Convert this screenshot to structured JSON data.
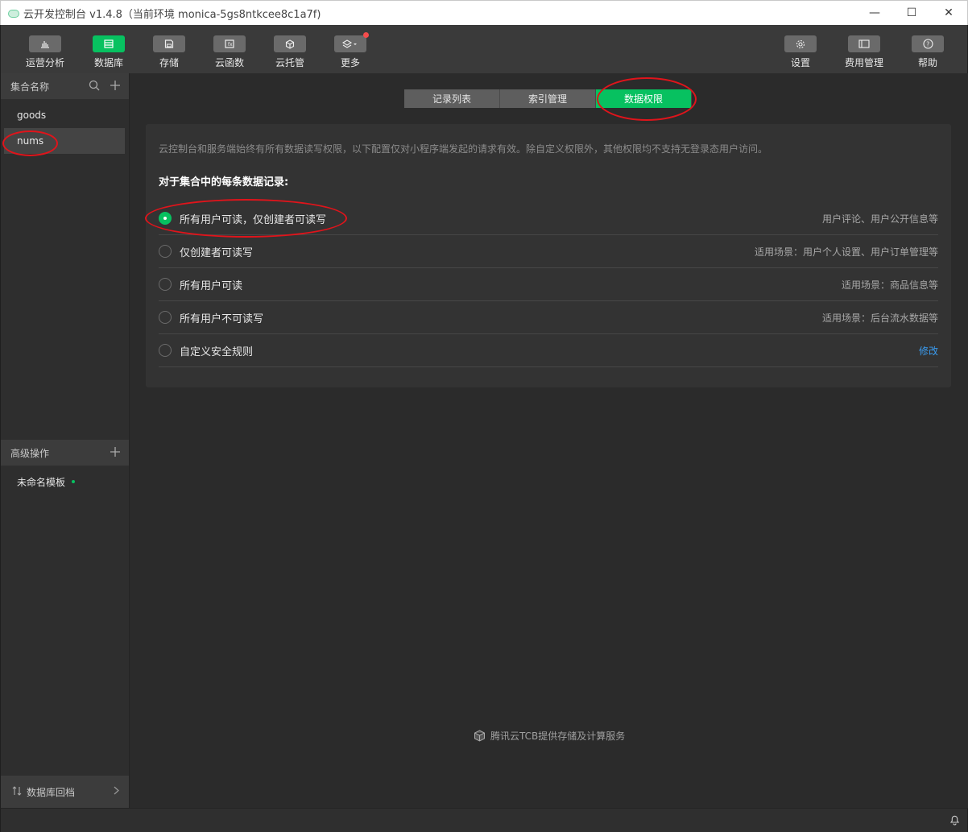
{
  "window": {
    "title": "云开发控制台 v1.4.8（当前环境 monica-5gs8ntkcee8c1a7f)",
    "minimize_glyph": "—",
    "maximize_glyph": "☐",
    "close_glyph": "✕"
  },
  "toolbar": {
    "left": [
      {
        "label": "运营分析",
        "icon": "bar-chart-icon",
        "active": false
      },
      {
        "label": "数据库",
        "icon": "database-icon",
        "active": true
      },
      {
        "label": "存储",
        "icon": "save-icon",
        "active": false
      },
      {
        "label": "云函数",
        "icon": "function-icon",
        "active": false
      },
      {
        "label": "云托管",
        "icon": "cube-icon",
        "active": false
      },
      {
        "label": "更多",
        "icon": "layers-icon",
        "active": false,
        "notification_dot": true
      }
    ],
    "right": [
      {
        "label": "设置",
        "icon": "gear-icon"
      },
      {
        "label": "费用管理",
        "icon": "billing-icon"
      },
      {
        "label": "帮助",
        "icon": "help-icon"
      }
    ]
  },
  "sidebar": {
    "collections_header": "集合名称",
    "collections": [
      {
        "name": "goods",
        "selected": false
      },
      {
        "name": "nums",
        "selected": true
      }
    ],
    "advanced_header": "高级操作",
    "advanced_items": [
      {
        "name": "未命名模板",
        "status_dot": true
      }
    ],
    "footer_label": "数据库回档"
  },
  "main": {
    "tabs": [
      {
        "label": "记录列表",
        "active": false
      },
      {
        "label": "索引管理",
        "active": false
      },
      {
        "label": "数据权限",
        "active": true
      }
    ],
    "description": "云控制台和服务端始终有所有数据读写权限，以下配置仅对小程序端发起的请求有效。除自定义权限外，其他权限均不支持无登录态用户访问。",
    "subheading": "对于集合中的每条数据记录:",
    "options": [
      {
        "label": "所有用户可读，仅创建者可读写",
        "note": "用户评论、用户公开信息等",
        "checked": true
      },
      {
        "label": "仅创建者可读写",
        "note": "适用场景：用户个人设置、用户订单管理等",
        "checked": false
      },
      {
        "label": "所有用户可读",
        "note": "适用场景：商品信息等",
        "checked": false
      },
      {
        "label": "所有用户不可读写",
        "note": "适用场景：后台流水数据等",
        "checked": false
      },
      {
        "label": "自定义安全规则",
        "note": "修改",
        "checked": false,
        "note_is_link": true
      }
    ],
    "provider": "腾讯云TCB提供存储及计算服务"
  },
  "colors": {
    "accent": "#07c160",
    "annotation": "#e0141b",
    "link": "#3a9cf0"
  }
}
